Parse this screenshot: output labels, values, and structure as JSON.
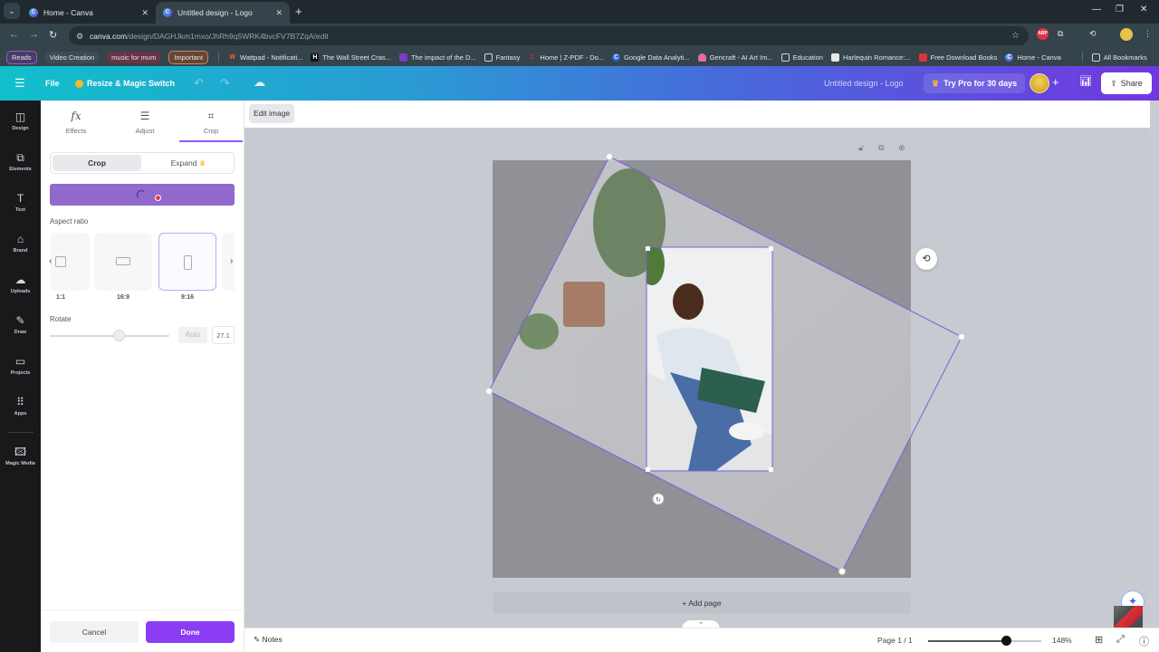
{
  "browser": {
    "tabs": [
      {
        "title": "Home - Canva",
        "active": false
      },
      {
        "title": "Untitled design - Logo",
        "active": true
      }
    ],
    "url_domain": "canva.com",
    "url_path": "/design/DAGHJkm1mxo/JhRh9q5WRK4bvcFV7B7ZqA/edit",
    "bookmarks_chips": [
      {
        "label": "Reads",
        "color": "#7a4fb0"
      },
      {
        "label": "Video Creation",
        "color": "#3d4b54"
      },
      {
        "label": "music for mum",
        "color": "#6a3348"
      },
      {
        "label": "Important",
        "color": "#7a4a33"
      }
    ],
    "bookmarks": [
      {
        "label": "Wattpad - Notificati...",
        "icon": "wattpad-icon"
      },
      {
        "label": "The Wall Street Cras...",
        "icon": "h-icon"
      },
      {
        "label": "The impact of the D...",
        "icon": "book-icon"
      },
      {
        "label": "Fantasy",
        "icon": "folder-icon"
      },
      {
        "label": "Home | Z-PDF - Do...",
        "icon": "z-icon"
      },
      {
        "label": "Google Data Analyti...",
        "icon": "coursera-icon"
      },
      {
        "label": "Gencraft - AI Art Im...",
        "icon": "gencraft-icon"
      },
      {
        "label": "Education",
        "icon": "folder-icon"
      },
      {
        "label": "Harlequin Romance:...",
        "icon": "harlequin-icon"
      },
      {
        "label": "Free Download Books",
        "icon": "books-icon"
      },
      {
        "label": "Home - Canva",
        "icon": "canva-icon"
      }
    ],
    "all_bookmarks": "All Bookmarks"
  },
  "header": {
    "file": "File",
    "resize": "Resize & Magic Switch",
    "design_title": "Untitled design - Logo",
    "try_pro": "Try Pro for 30 days",
    "share": "Share"
  },
  "rail": [
    {
      "label": "Design",
      "icon": "design-icon"
    },
    {
      "label": "Elements",
      "icon": "elements-icon"
    },
    {
      "label": "Text",
      "icon": "text-icon"
    },
    {
      "label": "Brand",
      "icon": "brand-icon"
    },
    {
      "label": "Uploads",
      "icon": "uploads-icon"
    },
    {
      "label": "Draw",
      "icon": "draw-icon"
    },
    {
      "label": "Projects",
      "icon": "projects-icon"
    },
    {
      "label": "Apps",
      "icon": "apps-icon"
    },
    {
      "label": "Magic Media",
      "icon": "magic-media-icon"
    }
  ],
  "panel": {
    "tabs": [
      {
        "label": "Effects",
        "icon": "fx-icon"
      },
      {
        "label": "Adjust",
        "icon": "sliders-icon"
      },
      {
        "label": "Crop",
        "icon": "crop-icon",
        "active": true
      }
    ],
    "segment": {
      "crop": "Crop",
      "expand": "Expand"
    },
    "aspect_ratio_label": "Aspect ratio",
    "ratios": [
      {
        "label": "1:1"
      },
      {
        "label": "16:9"
      },
      {
        "label": "9:16",
        "selected": true
      }
    ],
    "rotate_label": "Rotate",
    "rotate_auto": "Auto",
    "rotate_value": "27.1",
    "rotate_fraction": 0.575,
    "cancel": "Cancel",
    "done": "Done"
  },
  "workspace": {
    "edit_image": "Edit image",
    "add_page": "+ Add page"
  },
  "bottombar": {
    "notes": "Notes",
    "page_indicator": "Page 1 / 1",
    "zoom_value": "148%",
    "zoom_fraction": 0.69
  },
  "colors": {
    "accent_purple": "#8b3cf5",
    "crop_outline": "#7b5ce0"
  }
}
